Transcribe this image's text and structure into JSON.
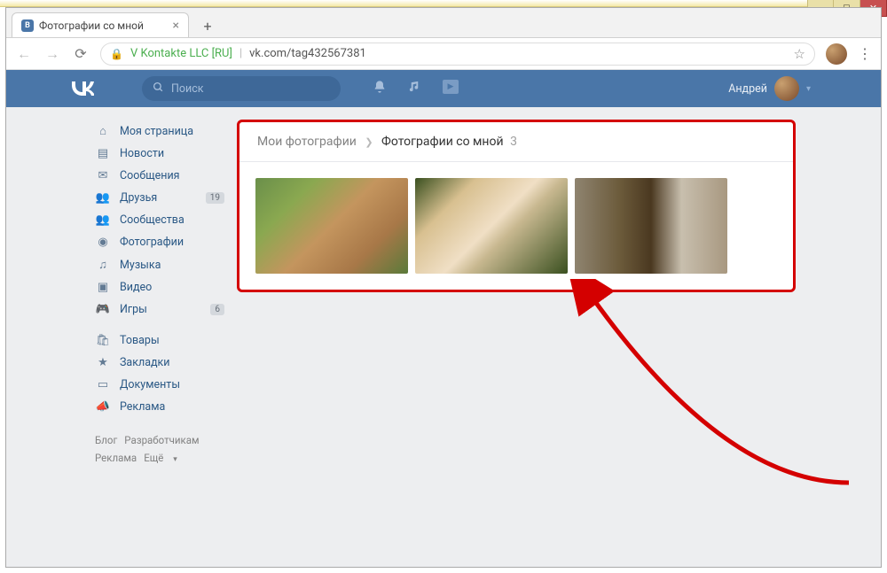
{
  "window": {
    "tab_title": "Фотографии со мной"
  },
  "browser": {
    "org": "V Kontakte LLC [RU]",
    "url": "vk.com/tag432567381"
  },
  "header": {
    "search_placeholder": "Поиск",
    "user_name": "Андрей"
  },
  "sidebar": {
    "items": [
      {
        "icon": "home",
        "label": "Моя страница",
        "badge": ""
      },
      {
        "icon": "news",
        "label": "Новости",
        "badge": ""
      },
      {
        "icon": "msg",
        "label": "Сообщения",
        "badge": ""
      },
      {
        "icon": "friends",
        "label": "Друзья",
        "badge": "19"
      },
      {
        "icon": "group",
        "label": "Сообщества",
        "badge": ""
      },
      {
        "icon": "photo",
        "label": "Фотографии",
        "badge": ""
      },
      {
        "icon": "music",
        "label": "Музыка",
        "badge": ""
      },
      {
        "icon": "video",
        "label": "Видео",
        "badge": ""
      },
      {
        "icon": "game",
        "label": "Игры",
        "badge": "6"
      }
    ],
    "items2": [
      {
        "icon": "market",
        "label": "Товары"
      },
      {
        "icon": "bookmark",
        "label": "Закладки"
      },
      {
        "icon": "doc",
        "label": "Документы"
      },
      {
        "icon": "ad",
        "label": "Реклама"
      }
    ],
    "footer": {
      "blog": "Блог",
      "devs": "Разработчикам",
      "ads": "Реклама",
      "more": "Ещё"
    }
  },
  "breadcrumb": {
    "root": "Мои фотографии",
    "current": "Фотографии со мной",
    "count": "3"
  }
}
